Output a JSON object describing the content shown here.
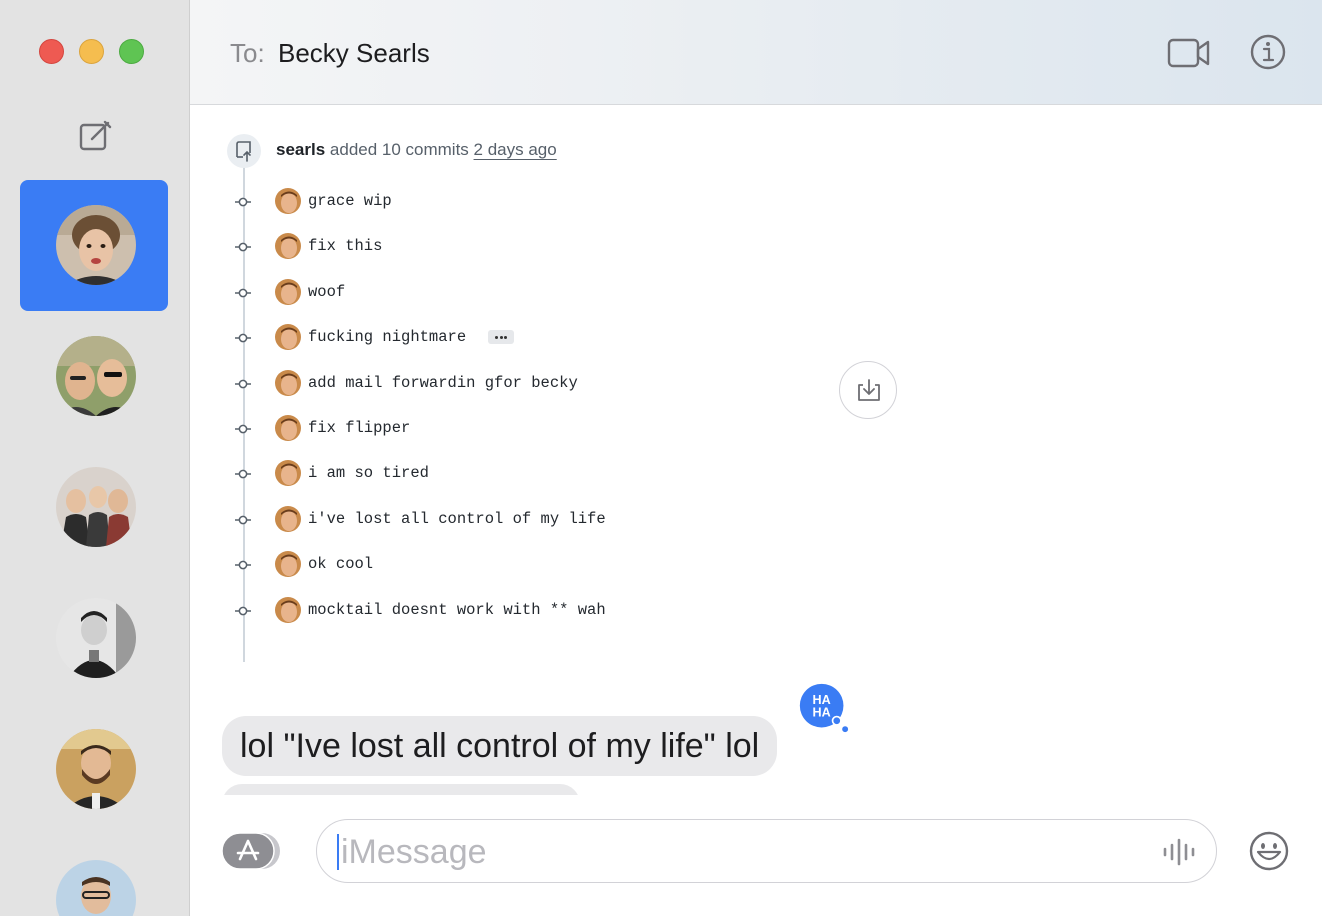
{
  "window": {
    "traffic_lights": [
      "close",
      "minimize",
      "zoom"
    ],
    "accent": "#3a7cf4"
  },
  "sidebar": {
    "compose_icon": "compose-icon",
    "conversations": [
      {
        "avatar": "avatar-becky",
        "selected": true
      },
      {
        "avatar": "avatar-two-men-sunglasses",
        "selected": false
      },
      {
        "avatar": "avatar-group-photo",
        "selected": false
      },
      {
        "avatar": "avatar-bw-portrait",
        "selected": false
      },
      {
        "avatar": "avatar-man-beard",
        "selected": false
      },
      {
        "avatar": "avatar-man-glasses",
        "selected": false
      }
    ]
  },
  "header": {
    "to_label": "To:",
    "recipient": "Becky Searls",
    "video_icon": "video-camera-icon",
    "info_icon": "info-icon"
  },
  "thread": {
    "push_event": {
      "user": "searls",
      "action": "added 10 commits",
      "time": "2 days ago"
    },
    "commits": [
      {
        "message": "grace wip"
      },
      {
        "message": "fix this"
      },
      {
        "message": "woof"
      },
      {
        "message": "fucking nightmare"
      },
      {
        "message": "add mail forwardin gfor becky"
      },
      {
        "message": "fix flipper"
      },
      {
        "message": "i am so tired"
      },
      {
        "message": "i've lost all control of my life"
      },
      {
        "message": "ok cool"
      },
      {
        "message": "mocktail doesnt work with ** wah"
      }
    ],
    "bubble_text": "lol \"Ive lost all control of my life\" lol",
    "tapback": "HA HA"
  },
  "composer": {
    "placeholder": "iMessage",
    "apps_icon": "app-store-icon",
    "audio_icon": "waveform-icon",
    "emoji_icon": "emoji-icon"
  }
}
